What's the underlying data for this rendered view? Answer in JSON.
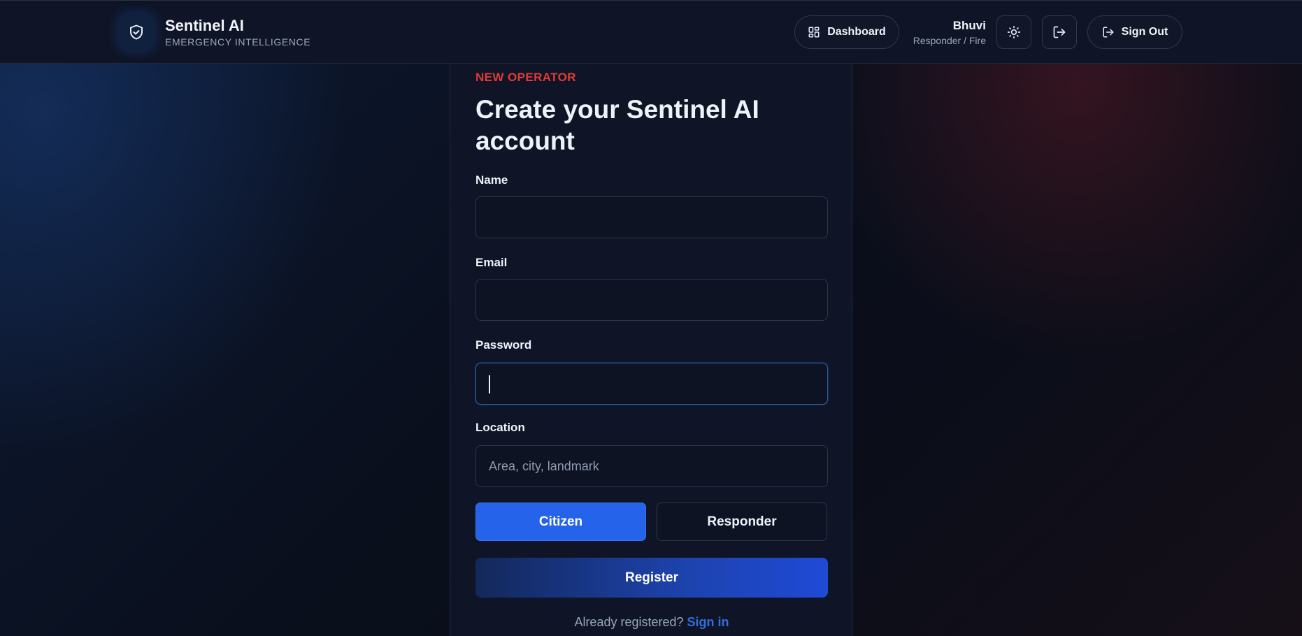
{
  "header": {
    "brand_name": "Sentinel AI",
    "brand_tagline": "EMERGENCY INTELLIGENCE",
    "dashboard_label": "Dashboard",
    "user_name": "Bhuvi",
    "user_role": "Responder / Fire",
    "signout_label": "Sign Out",
    "icons": {
      "logo": "shield-check-icon",
      "dashboard": "grid-icon",
      "theme": "sun-icon",
      "exit": "logout-icon",
      "signout": "logout-icon"
    }
  },
  "form": {
    "eyebrow": "NEW OPERATOR",
    "title": "Create your Sentinel AI account",
    "fields": {
      "name": {
        "label": "Name",
        "value": "",
        "placeholder": ""
      },
      "email": {
        "label": "Email",
        "value": "",
        "placeholder": ""
      },
      "password": {
        "label": "Password",
        "value": "",
        "placeholder": ""
      },
      "location": {
        "label": "Location",
        "value": "",
        "placeholder": "Area, city, landmark"
      }
    },
    "roles": {
      "citizen": "Citizen",
      "responder": "Responder",
      "selected": "Citizen"
    },
    "register_label": "Register",
    "signin_prompt": "Already registered?",
    "signin_link": "Sign in"
  },
  "colors": {
    "accent": "#2563eb",
    "eyebrow": "#e03a3a",
    "link": "#2f6fe0",
    "surface": "#0f1526"
  }
}
